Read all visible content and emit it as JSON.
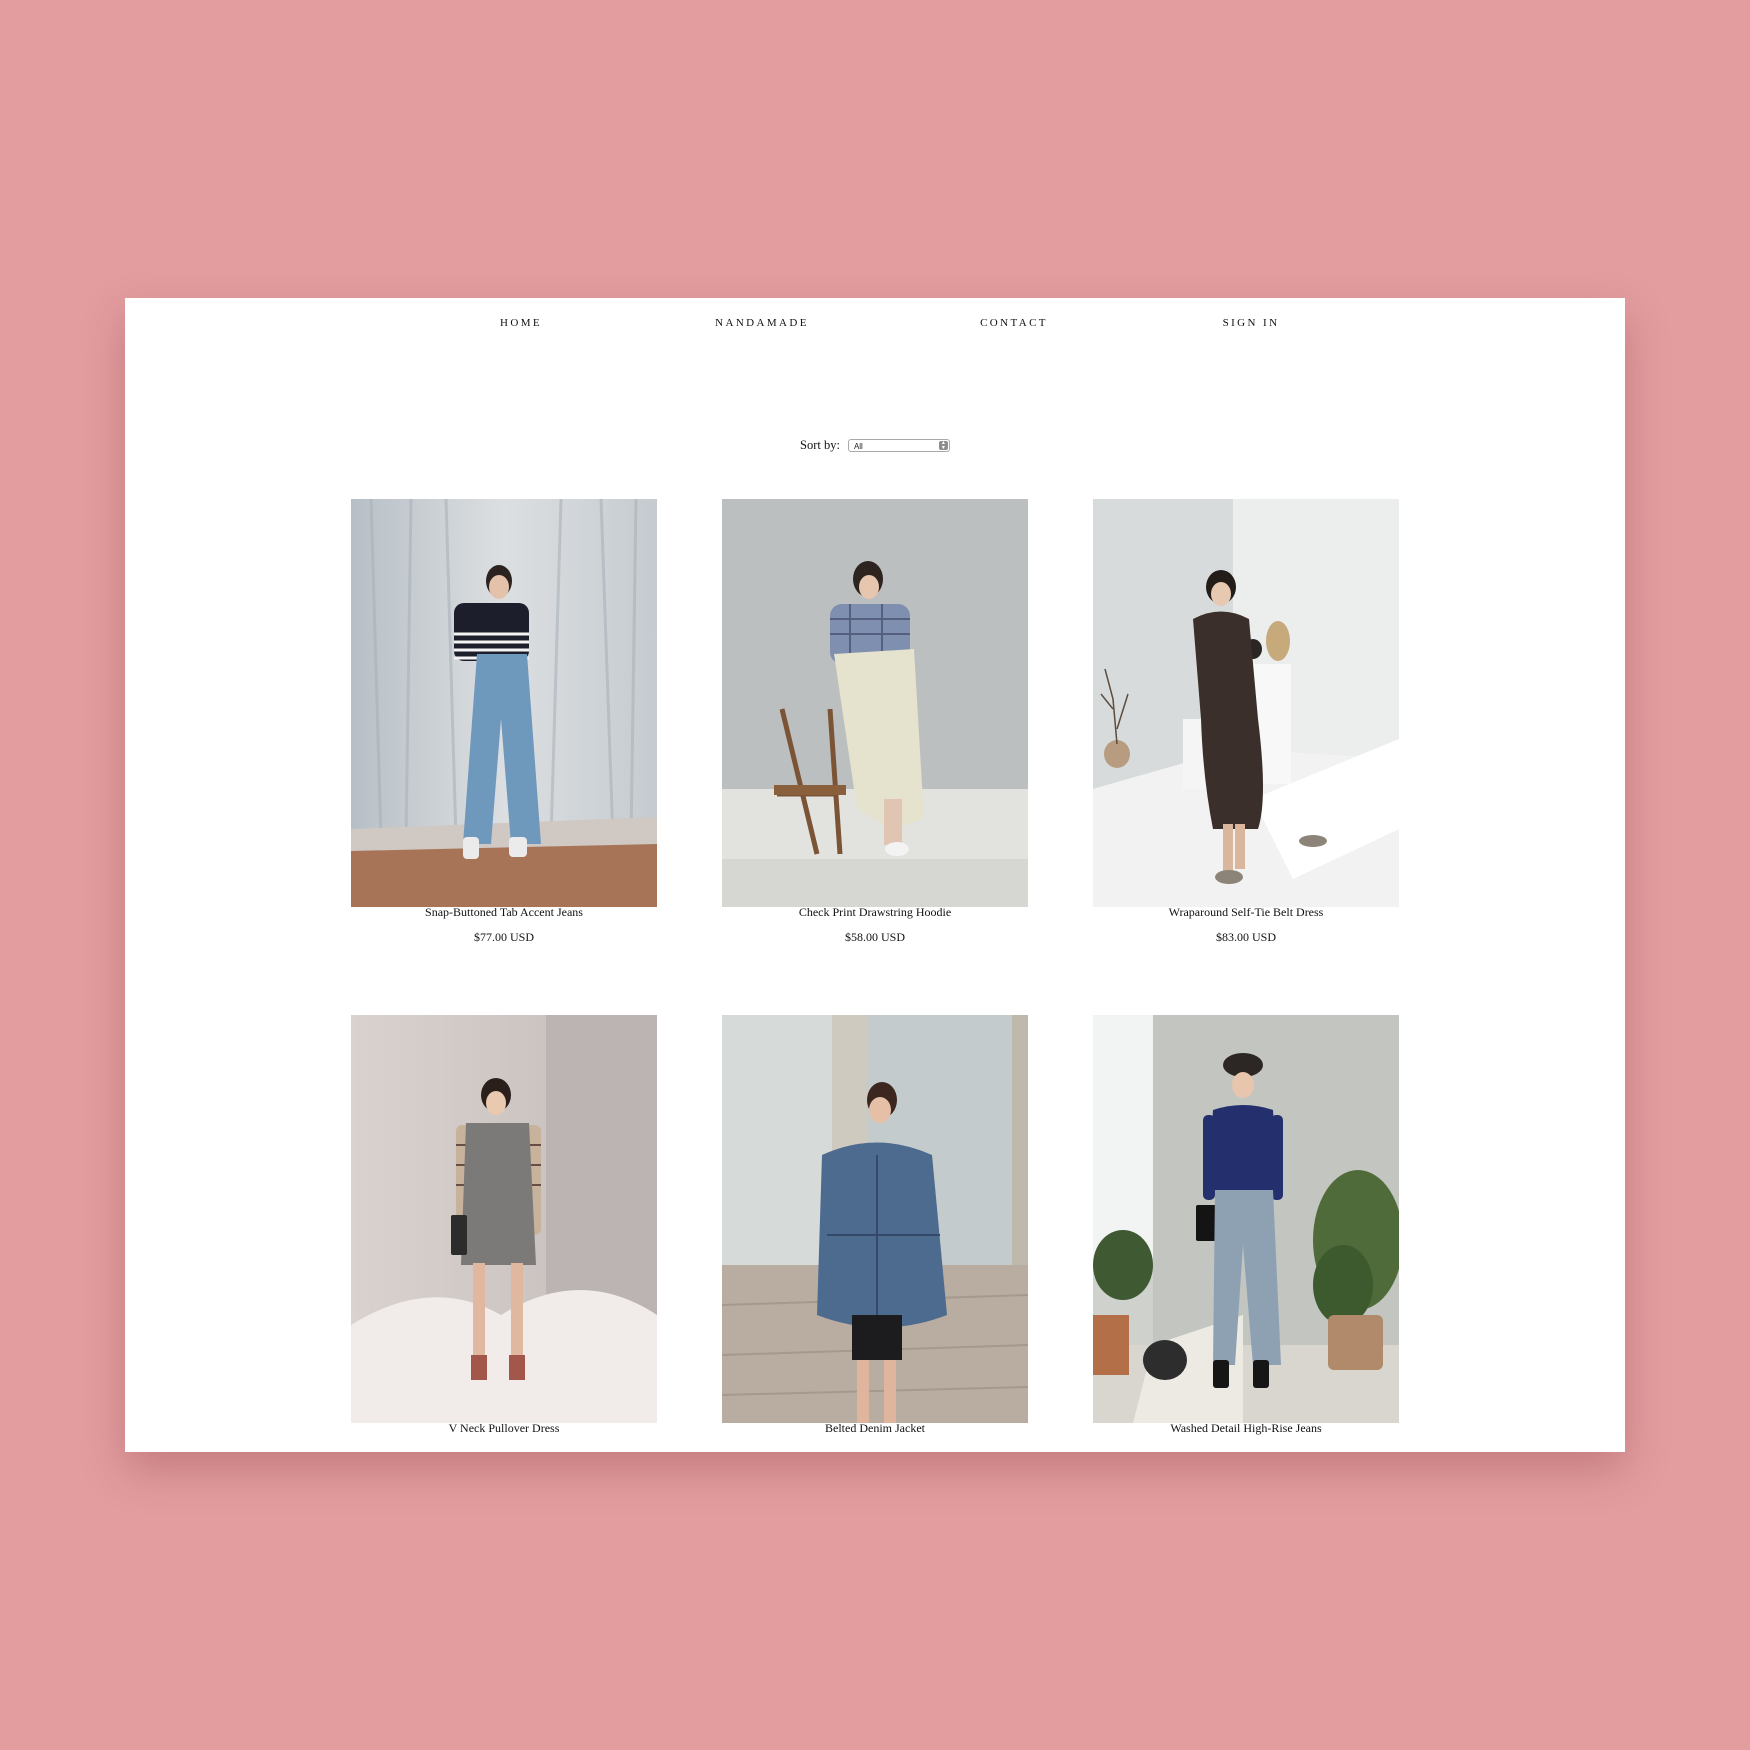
{
  "nav": {
    "items": [
      "HOME",
      "NANDAMADE",
      "CONTACT",
      "SIGN IN"
    ]
  },
  "sort": {
    "label": "Sort by:",
    "selected": "All"
  },
  "products": [
    {
      "name": "Snap-Buttoned Tab Accent Jeans",
      "price": "$77.00 USD"
    },
    {
      "name": "Check Print Drawstring Hoodie",
      "price": "$58.00 USD"
    },
    {
      "name": "Wraparound Self-Tie Belt Dress",
      "price": "$83.00 USD"
    },
    {
      "name": "V Neck Pullover Dress",
      "price": ""
    },
    {
      "name": "Belted Denim Jacket",
      "price": ""
    },
    {
      "name": "Washed Detail High-Rise Jeans",
      "price": ""
    }
  ],
  "colors": {
    "background": "#e39d9f",
    "page": "#ffffff",
    "text": "#111111"
  }
}
